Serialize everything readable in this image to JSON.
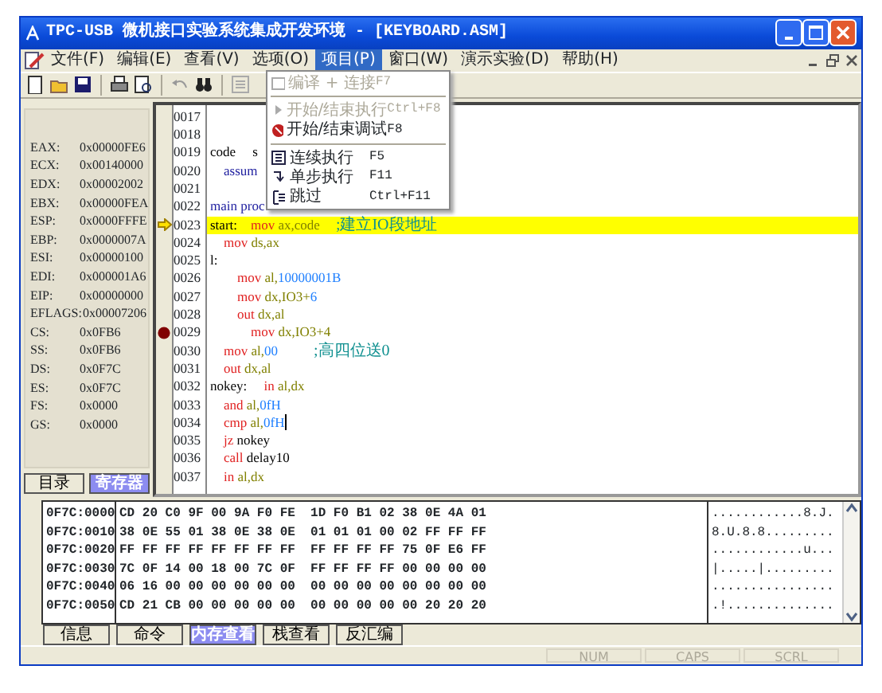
{
  "window": {
    "title": "TPC-USB 微机接口实验系统集成开发环境 - [KEYBOARD.ASM]"
  },
  "menu": [
    {
      "label": "文件(F)",
      "selected": false
    },
    {
      "label": "编辑(E)",
      "selected": false
    },
    {
      "label": "查看(V)",
      "selected": false
    },
    {
      "label": "选项(O)",
      "selected": false
    },
    {
      "label": "项目(P)",
      "selected": true
    },
    {
      "label": "窗口(W)",
      "selected": false
    },
    {
      "label": "演示实验(D)",
      "selected": false
    },
    {
      "label": "帮助(H)",
      "selected": false
    }
  ],
  "dropdown": [
    {
      "kind": "item",
      "label": "编译 + 连接",
      "shortcut": "F7",
      "disabled": true
    },
    {
      "kind": "separator"
    },
    {
      "kind": "item",
      "label": "开始/结束执行",
      "shortcut": "Ctrl+F8",
      "disabled": true
    },
    {
      "kind": "item",
      "label": "开始/结束调试",
      "shortcut": "F8",
      "disabled": false
    },
    {
      "kind": "separator"
    },
    {
      "kind": "item",
      "label": "连续执行",
      "shortcut": "F5",
      "disabled": false
    },
    {
      "kind": "item",
      "label": "单步执行",
      "shortcut": "F11",
      "disabled": false
    },
    {
      "kind": "item",
      "label": "跳过",
      "shortcut": "Ctrl+F11",
      "disabled": false
    }
  ],
  "registers": [
    {
      "name": "EAX:",
      "value": "0x00000FE6"
    },
    {
      "name": "ECX:",
      "value": "0x00140000"
    },
    {
      "name": "EDX:",
      "value": "0x00002002"
    },
    {
      "name": "EBX:",
      "value": "0x00000FEA"
    },
    {
      "name": "ESP:",
      "value": "0x0000FFFE"
    },
    {
      "name": "EBP:",
      "value": "0x0000007A"
    },
    {
      "name": "ESI:",
      "value": "0x00000100"
    },
    {
      "name": "EDI:",
      "value": "0x000001A6"
    },
    {
      "name": "EIP:",
      "value": "0x00000000"
    },
    {
      "name": "EFLAGS:",
      "value": "0x00007206"
    },
    {
      "name": "CS:",
      "value": "0x0FB6"
    },
    {
      "name": "SS:",
      "value": "0x0FB6"
    },
    {
      "name": "DS:",
      "value": "0x0F7C"
    },
    {
      "name": "ES:",
      "value": "0x0F7C"
    },
    {
      "name": "FS:",
      "value": "0x0000"
    },
    {
      "name": "GS:",
      "value": "0x0000"
    }
  ],
  "left_tabs": [
    {
      "label": "目录",
      "selected": false
    },
    {
      "label": "寄存器",
      "selected": true
    }
  ],
  "code": [
    {
      "number": "0017",
      "current": false,
      "breakpoint": false
    },
    {
      "number": "0018",
      "current": false,
      "breakpoint": false
    },
    {
      "number": "0019",
      "current": false,
      "breakpoint": false,
      "parts": [
        {
          "text": "code     s",
          "kind": "label"
        }
      ]
    },
    {
      "number": "0020",
      "current": false,
      "breakpoint": false,
      "parts": [
        {
          "text": "    assum",
          "kind": "directive"
        }
      ]
    },
    {
      "number": "0021",
      "current": false,
      "breakpoint": false
    },
    {
      "number": "0022",
      "current": false,
      "breakpoint": false,
      "parts": [
        {
          "text": "main proc",
          "kind": "directive"
        }
      ]
    },
    {
      "number": "0023",
      "current": true,
      "breakpoint": false,
      "parts": [
        {
          "text": "start:",
          "kind": "label"
        },
        {
          "text": "    mov",
          "kind": "op"
        },
        {
          "text": " ax,code",
          "kind": "arg"
        },
        {
          "text": "    ;建立IO段地址",
          "kind": "comment"
        }
      ]
    },
    {
      "number": "0024",
      "current": false,
      "breakpoint": false,
      "parts": [
        {
          "text": "    mov",
          "kind": "op"
        },
        {
          "text": " ds,ax",
          "kind": "arg"
        }
      ]
    },
    {
      "number": "0025",
      "current": false,
      "breakpoint": false,
      "parts": [
        {
          "text": "l:",
          "kind": "label"
        }
      ]
    },
    {
      "number": "0026",
      "current": false,
      "breakpoint": false,
      "parts": [
        {
          "text": "        mov",
          "kind": "op"
        },
        {
          "text": " al,",
          "kind": "arg"
        },
        {
          "text": "10000001B",
          "kind": "num"
        }
      ]
    },
    {
      "number": "0027",
      "current": false,
      "breakpoint": false,
      "parts": [
        {
          "text": "        mov",
          "kind": "op"
        },
        {
          "text": " dx,IO3+",
          "kind": "arg"
        },
        {
          "text": "6",
          "kind": "num"
        }
      ]
    },
    {
      "number": "0028",
      "current": false,
      "breakpoint": false,
      "parts": [
        {
          "text": "        out",
          "kind": "op"
        },
        {
          "text": " dx,al",
          "kind": "arg"
        }
      ]
    },
    {
      "number": "0029",
      "current": false,
      "breakpoint": true,
      "parts": [
        {
          "text": "            mov",
          "kind": "op"
        },
        {
          "text": " dx,IO3+4",
          "kind": "arg"
        }
      ]
    },
    {
      "number": "0030",
      "current": false,
      "breakpoint": false,
      "parts": [
        {
          "text": "    mov",
          "kind": "op"
        },
        {
          "text": " al,",
          "kind": "arg"
        },
        {
          "text": "00",
          "kind": "num"
        },
        {
          "text": "         ;高四位送0",
          "kind": "comment"
        }
      ]
    },
    {
      "number": "0031",
      "current": false,
      "breakpoint": false,
      "parts": [
        {
          "text": "    out",
          "kind": "op"
        },
        {
          "text": " dx,al",
          "kind": "arg"
        }
      ]
    },
    {
      "number": "0032",
      "current": false,
      "breakpoint": false,
      "parts": [
        {
          "text": "nokey:",
          "kind": "label"
        },
        {
          "text": "     in",
          "kind": "op"
        },
        {
          "text": " al,dx",
          "kind": "arg"
        }
      ]
    },
    {
      "number": "0033",
      "current": false,
      "breakpoint": false,
      "parts": [
        {
          "text": "    and",
          "kind": "op"
        },
        {
          "text": " al,",
          "kind": "arg"
        },
        {
          "text": "0fH",
          "kind": "num"
        }
      ]
    },
    {
      "number": "0034",
      "current": false,
      "breakpoint": false,
      "parts": [
        {
          "text": "    cmp",
          "kind": "op"
        },
        {
          "text": " al,",
          "kind": "arg"
        },
        {
          "text": "0fH",
          "kind": "num"
        },
        {
          "kind": "cursor"
        }
      ]
    },
    {
      "number": "0035",
      "current": false,
      "breakpoint": false,
      "parts": [
        {
          "text": "    jz",
          "kind": "op"
        },
        {
          "text": " nokey",
          "kind": "label"
        }
      ]
    },
    {
      "number": "0036",
      "current": false,
      "breakpoint": false,
      "parts": [
        {
          "text": "    call",
          "kind": "op"
        },
        {
          "text": " delay10",
          "kind": "label"
        }
      ]
    },
    {
      "number": "0037",
      "current": false,
      "breakpoint": false,
      "parts": [
        {
          "text": "    in",
          "kind": "op"
        },
        {
          "text": " al,dx",
          "kind": "arg"
        }
      ]
    }
  ],
  "memory": [
    {
      "address": "0F7C:0000",
      "bytes": "CD 20 C0 9F 00 9A F0 FE  1D F0 B1 02 38 0E 4A 01",
      "ascii": "............8.J."
    },
    {
      "address": "0F7C:0010",
      "bytes": "38 0E 55 01 38 0E 38 0E  01 01 01 00 02 FF FF FF",
      "ascii": "8.U.8.8........."
    },
    {
      "address": "0F7C:0020",
      "bytes": "FF FF FF FF FF FF FF FF  FF FF FF FF 75 0F E6 FF",
      "ascii": "............u..."
    },
    {
      "address": "0F7C:0030",
      "bytes": "7C 0F 14 00 18 00 7C 0F  FF FF FF FF 00 00 00 00",
      "ascii": "|.....|........."
    },
    {
      "address": "0F7C:0040",
      "bytes": "06 16 00 00 00 00 00 00  00 00 00 00 00 00 00 00",
      "ascii": "................"
    },
    {
      "address": "0F7C:0050",
      "bytes": "CD 21 CB 00 00 00 00 00  00 00 00 00 00 20 20 20",
      "ascii": ".!.............."
    }
  ],
  "bottom_tabs": [
    {
      "label": "信息",
      "selected": false
    },
    {
      "label": "命令",
      "selected": false
    },
    {
      "label": "内存查看",
      "selected": true
    },
    {
      "label": "栈查看",
      "selected": false
    },
    {
      "label": "反汇编",
      "selected": false
    }
  ],
  "status_bar": [
    {
      "label": "NUM"
    },
    {
      "label": "CAPS"
    },
    {
      "label": "SCRL"
    }
  ]
}
